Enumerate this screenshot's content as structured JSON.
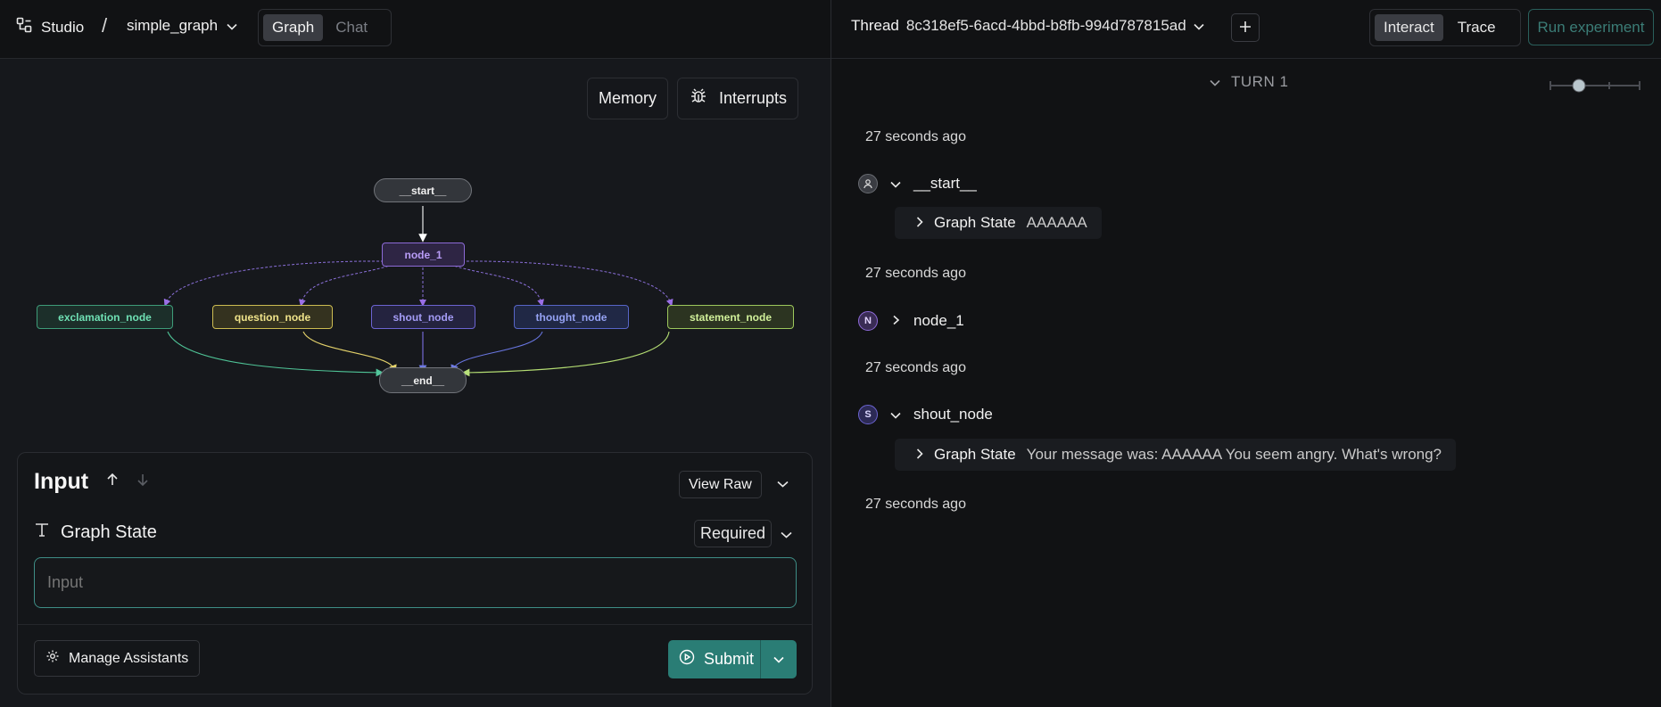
{
  "header": {
    "app_name": "Studio",
    "separator": "/",
    "graph_name": "simple_graph",
    "view_tabs": [
      {
        "label": "Graph",
        "active": true
      },
      {
        "label": "Chat",
        "active": false
      }
    ]
  },
  "graph_panel": {
    "buttons": {
      "memory": "Memory",
      "interrupts": "Interrupts"
    },
    "nodes": {
      "start": "__start__",
      "node_1": "node_1",
      "exclamation": "exclamation_node",
      "question": "question_node",
      "shout": "shout_node",
      "thought": "thought_node",
      "statement": "statement_node",
      "end": "__end__"
    },
    "node_colors": {
      "node_1": "#a27cf0",
      "exclamation": "#5bd1a6",
      "question": "#e8d879",
      "shout": "#8b80ee",
      "thought": "#7c8ae9",
      "statement": "#c3e787"
    }
  },
  "input_panel": {
    "title": "Input",
    "view_raw": "View Raw",
    "field_label": "Graph State",
    "required": "Required",
    "input_placeholder": "Input",
    "manage_assistants": "Manage Assistants",
    "submit": "Submit"
  },
  "thread_bar": {
    "label": "Thread",
    "thread_id": "8c318ef5-6acd-4bbd-b8fb-994d787815ad",
    "mode_tabs": [
      {
        "label": "Interact",
        "active": true
      },
      {
        "label": "Trace",
        "active": false
      }
    ],
    "run_experiment": "Run experiment"
  },
  "thread": {
    "turn_label": "TURN 1",
    "events": [
      {
        "timestamp": "27 seconds ago",
        "avatar": "",
        "node": "__start__",
        "expanded": true,
        "state_key": "Graph State",
        "state_value": "AAAAAA"
      },
      {
        "timestamp": "27 seconds ago",
        "avatar": "N",
        "node": "node_1",
        "expanded": false
      },
      {
        "timestamp": "27 seconds ago",
        "avatar": "S",
        "node": "shout_node",
        "expanded": true,
        "state_key": "Graph State",
        "state_value": "Your message was: AAAAAA You seem angry. What's wrong?"
      }
    ],
    "final_timestamp": "27 seconds ago"
  },
  "colors": {
    "accent": "#2a7d75",
    "accent_border": "#3e8d86"
  }
}
